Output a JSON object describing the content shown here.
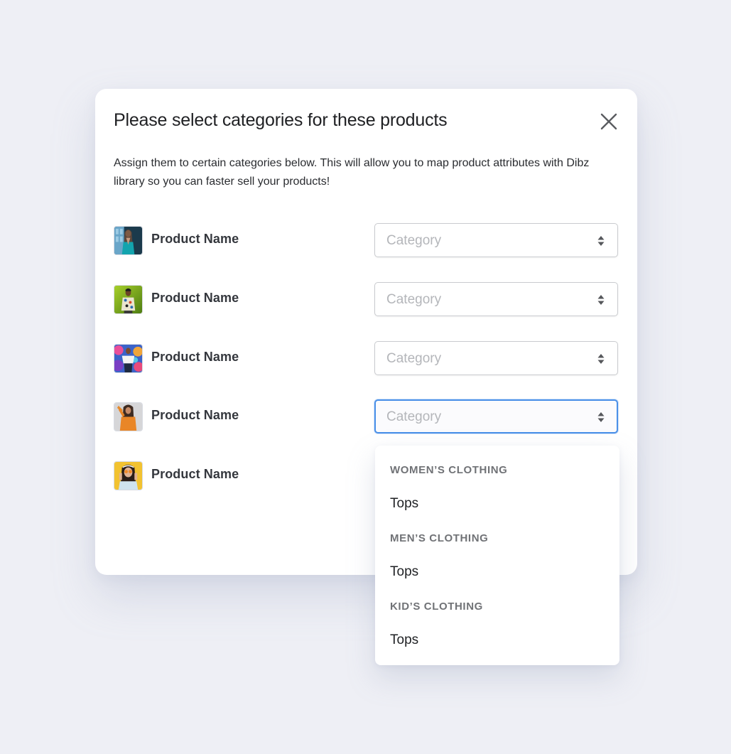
{
  "modal": {
    "title": "Please select categories for these products",
    "description": "Assign them to certain categories below. This will allow you to map product attributes with Dibz library so you can faster sell your products!",
    "close_icon": "close-icon"
  },
  "products": [
    {
      "name": "Product Name",
      "thumbnail": "woman-teal-dress-photo",
      "category_placeholder": "Category",
      "focused": false
    },
    {
      "name": "Product Name",
      "thumbnail": "man-patterned-shirt-photo",
      "category_placeholder": "Category",
      "focused": false
    },
    {
      "name": "Product Name",
      "thumbnail": "person-colorful-mural-photo",
      "category_placeholder": "Category",
      "focused": false
    },
    {
      "name": "Product Name",
      "thumbnail": "woman-orange-sweater-photo",
      "category_placeholder": "Category",
      "focused": true
    },
    {
      "name": "Product Name",
      "thumbnail": "woman-yellow-sunglasses-photo",
      "category_placeholder": "Category",
      "focused": false
    }
  ],
  "dropdown": {
    "groups": [
      {
        "label": "WOMEN’S CLOTHING",
        "options": [
          "Tops"
        ]
      },
      {
        "label": "MEN’S CLOTHING",
        "options": [
          "Tops"
        ]
      },
      {
        "label": "KID’S CLOTHING",
        "options": [
          "Tops"
        ]
      }
    ]
  },
  "colors": {
    "focus_border": "#4a90e8",
    "background": "#eeeff5",
    "placeholder": "#b4b6ba"
  }
}
